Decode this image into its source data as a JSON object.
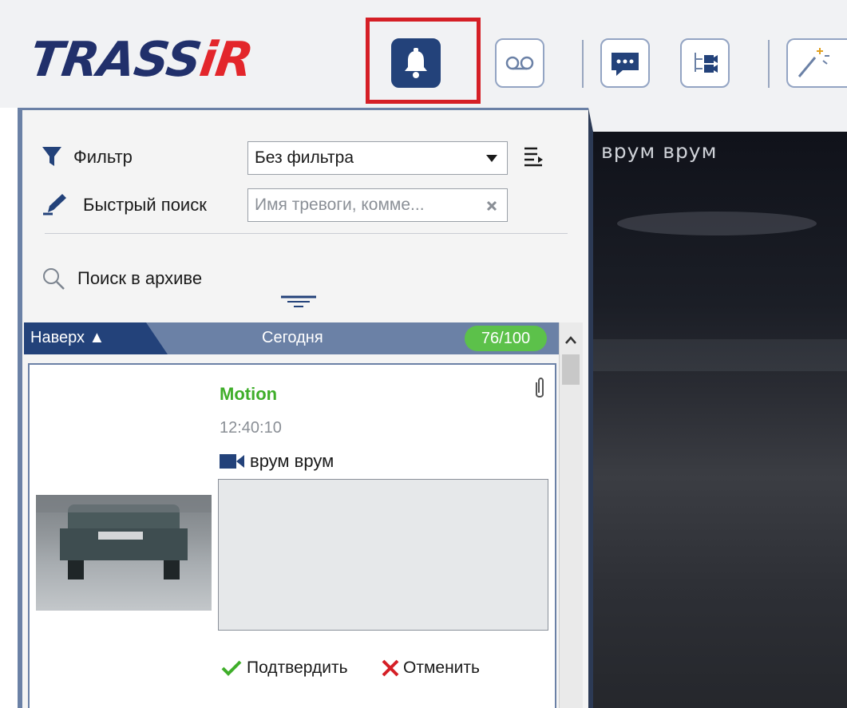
{
  "logo": {
    "text_main": "TRASS",
    "text_i": "i",
    "text_r": "R"
  },
  "toolbar": {
    "buttons": [
      {
        "name": "alarms",
        "icon": "bell-icon"
      },
      {
        "name": "voicemail",
        "icon": "voicemail-icon"
      },
      {
        "name": "chat",
        "icon": "chat-icon"
      },
      {
        "name": "devices",
        "icon": "device-tree-icon"
      },
      {
        "name": "wizard",
        "icon": "magic-wand-icon"
      }
    ]
  },
  "filter": {
    "label": "Фильтр",
    "value": "Без фильтра"
  },
  "quick_search": {
    "label": "Быстрый поиск",
    "placeholder": "Имя тревоги, комме..."
  },
  "archive_search": {
    "label": "Поиск в архиве"
  },
  "list_header": {
    "up_label": "Наверх ▲",
    "date_label": "Сегодня",
    "count": "76/100"
  },
  "event": {
    "type": "Motion",
    "time": "12:40:10",
    "camera": "врум врум",
    "confirm_label": "Подтвердить",
    "cancel_label": "Отменить"
  },
  "video": {
    "label": "врум врум"
  },
  "colors": {
    "accent_blue": "#6b81a6",
    "dark_blue": "#23427a",
    "highlight_red": "#d51f26",
    "motion_green": "#3fae2a",
    "badge_green": "#5cc14a"
  }
}
